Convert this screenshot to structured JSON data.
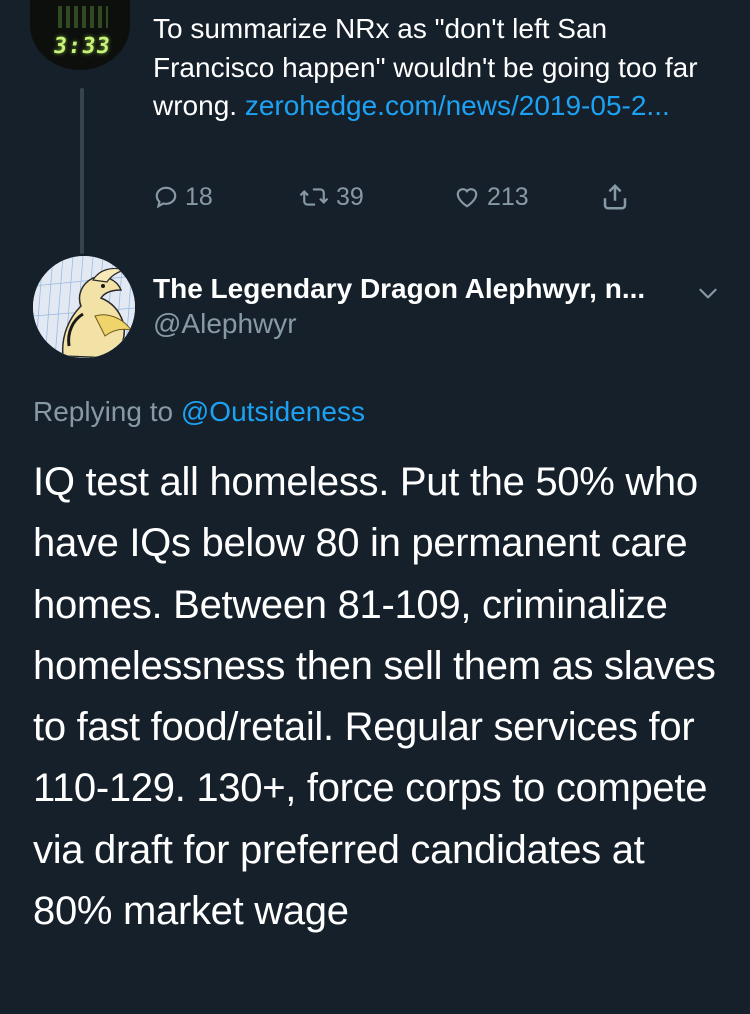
{
  "parent_tweet": {
    "avatar_clock": "3:33",
    "text": "To summarize NRx as \"don't left San Francisco happen\" wouldn't be going too far wrong.",
    "link": "zerohedge.com/news/2019-05-2...",
    "actions": {
      "replies": "18",
      "retweets": "39",
      "likes": "213"
    }
  },
  "tweet": {
    "author_name": "The Legendary Dragon Alephwyr, n...",
    "author_handle": "@Alephwyr",
    "replying_prefix": "Replying to",
    "replying_to": "@Outsideness",
    "text": "IQ test all homeless. Put the 50% who have IQs below 80 in permanent care homes. Between 81-109, criminalize homelessness then sell them as slaves to fast food/retail. Regular services for 110-129. 130+, force corps to compete via draft for preferred candidates at 80% market wage"
  },
  "icons": [
    "reply-icon",
    "retweet-icon",
    "like-icon",
    "share-icon",
    "chevron-down-icon"
  ],
  "colors": {
    "background": "#15202b",
    "text": "#ffffff",
    "secondary": "#8899a6",
    "link": "#1da1f2",
    "divider": "#38444d"
  }
}
